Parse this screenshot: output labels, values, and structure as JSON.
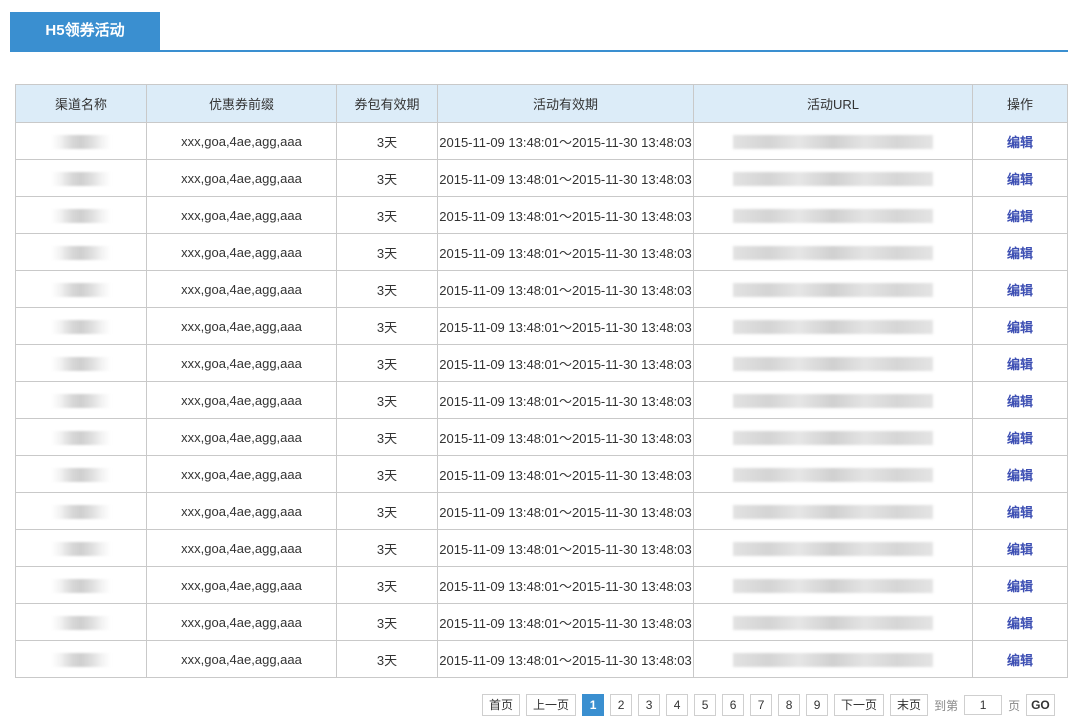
{
  "tab": {
    "title": "H5领券活动"
  },
  "table": {
    "headers": [
      "渠道名称",
      "优惠券前缀",
      "券包有效期",
      "活动有效期",
      "活动URL",
      "操作"
    ],
    "rows": [
      {
        "prefix": "xxx,goa,4ae,agg,aaa",
        "pack_validity": "3天",
        "activity_validity": "2015-11-09 13:48:01～2015-11-30 13:48:03",
        "action": "编辑"
      },
      {
        "prefix": "xxx,goa,4ae,agg,aaa",
        "pack_validity": "3天",
        "activity_validity": "2015-11-09 13:48:01～2015-11-30 13:48:03",
        "action": "编辑"
      },
      {
        "prefix": "xxx,goa,4ae,agg,aaa",
        "pack_validity": "3天",
        "activity_validity": "2015-11-09 13:48:01～2015-11-30 13:48:03",
        "action": "编辑"
      },
      {
        "prefix": "xxx,goa,4ae,agg,aaa",
        "pack_validity": "3天",
        "activity_validity": "2015-11-09 13:48:01～2015-11-30 13:48:03",
        "action": "编辑"
      },
      {
        "prefix": "xxx,goa,4ae,agg,aaa",
        "pack_validity": "3天",
        "activity_validity": "2015-11-09 13:48:01～2015-11-30 13:48:03",
        "action": "编辑"
      },
      {
        "prefix": "xxx,goa,4ae,agg,aaa",
        "pack_validity": "3天",
        "activity_validity": "2015-11-09 13:48:01～2015-11-30 13:48:03",
        "action": "编辑"
      },
      {
        "prefix": "xxx,goa,4ae,agg,aaa",
        "pack_validity": "3天",
        "activity_validity": "2015-11-09 13:48:01～2015-11-30 13:48:03",
        "action": "编辑"
      },
      {
        "prefix": "xxx,goa,4ae,agg,aaa",
        "pack_validity": "3天",
        "activity_validity": "2015-11-09 13:48:01～2015-11-30 13:48:03",
        "action": "编辑"
      },
      {
        "prefix": "xxx,goa,4ae,agg,aaa",
        "pack_validity": "3天",
        "activity_validity": "2015-11-09 13:48:01～2015-11-30 13:48:03",
        "action": "编辑"
      },
      {
        "prefix": "xxx,goa,4ae,agg,aaa",
        "pack_validity": "3天",
        "activity_validity": "2015-11-09 13:48:01～2015-11-30 13:48:03",
        "action": "编辑"
      },
      {
        "prefix": "xxx,goa,4ae,agg,aaa",
        "pack_validity": "3天",
        "activity_validity": "2015-11-09 13:48:01～2015-11-30 13:48:03",
        "action": "编辑"
      },
      {
        "prefix": "xxx,goa,4ae,agg,aaa",
        "pack_validity": "3天",
        "activity_validity": "2015-11-09 13:48:01～2015-11-30 13:48:03",
        "action": "编辑"
      },
      {
        "prefix": "xxx,goa,4ae,agg,aaa",
        "pack_validity": "3天",
        "activity_validity": "2015-11-09 13:48:01～2015-11-30 13:48:03",
        "action": "编辑"
      },
      {
        "prefix": "xxx,goa,4ae,agg,aaa",
        "pack_validity": "3天",
        "activity_validity": "2015-11-09 13:48:01～2015-11-30 13:48:03",
        "action": "编辑"
      },
      {
        "prefix": "xxx,goa,4ae,agg,aaa",
        "pack_validity": "3天",
        "activity_validity": "2015-11-09 13:48:01～2015-11-30 13:48:03",
        "action": "编辑"
      }
    ]
  },
  "pagination": {
    "first": "首页",
    "prev": "上一页",
    "pages": [
      "1",
      "2",
      "3",
      "4",
      "5",
      "6",
      "7",
      "8",
      "9"
    ],
    "current": "1",
    "next": "下一页",
    "last": "末页",
    "goto_prefix": "到第",
    "goto_value": "1",
    "goto_suffix": "页",
    "go": "GO"
  },
  "colors": {
    "accent": "#3a8fd0",
    "header_bg": "#dcecf8",
    "link": "#3d4fb3"
  }
}
